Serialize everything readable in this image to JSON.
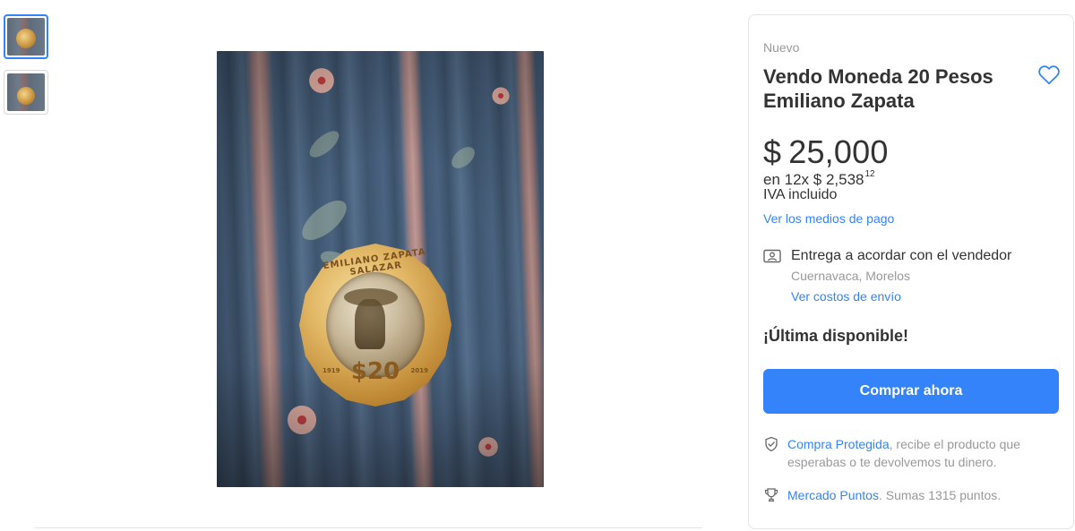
{
  "gallery": {
    "thumbnails": [
      {
        "alt": "coin-photo-1",
        "active": true
      },
      {
        "alt": "coin-photo-2",
        "active": false
      }
    ],
    "coin_inscription": "EMILIANO ZAPATA SALAZAR",
    "coin_denomination": "$20",
    "coin_year_left": "1919",
    "coin_year_right": "2019"
  },
  "product": {
    "condition": "Nuevo",
    "title": "Vendo Moneda 20 Pesos Emiliano Zapata",
    "currency": "$",
    "price": "25,000",
    "installments_prefix": "en 12x $ 2,538",
    "installments_cents": "12",
    "tax_note": "IVA incluido",
    "payment_link": "Ver los medios de pago"
  },
  "shipping": {
    "icon": "delivery-agreement-icon",
    "title": "Entrega a acordar con el vendedor",
    "location": "Cuernavaca, Morelos",
    "costs_link": "Ver costos de envío"
  },
  "stock": {
    "label": "¡Última disponible!"
  },
  "actions": {
    "buy_now": "Comprar ahora"
  },
  "benefits": {
    "protected_link": "Compra Protegida",
    "protected_text": ", recibe el producto que esperabas o te devolvemos tu dinero.",
    "points_link": "Mercado Puntos",
    "points_text": ". Sumas 1315 puntos."
  },
  "colors": {
    "accent": "#3483fa",
    "text": "#333333",
    "muted": "#999999"
  }
}
